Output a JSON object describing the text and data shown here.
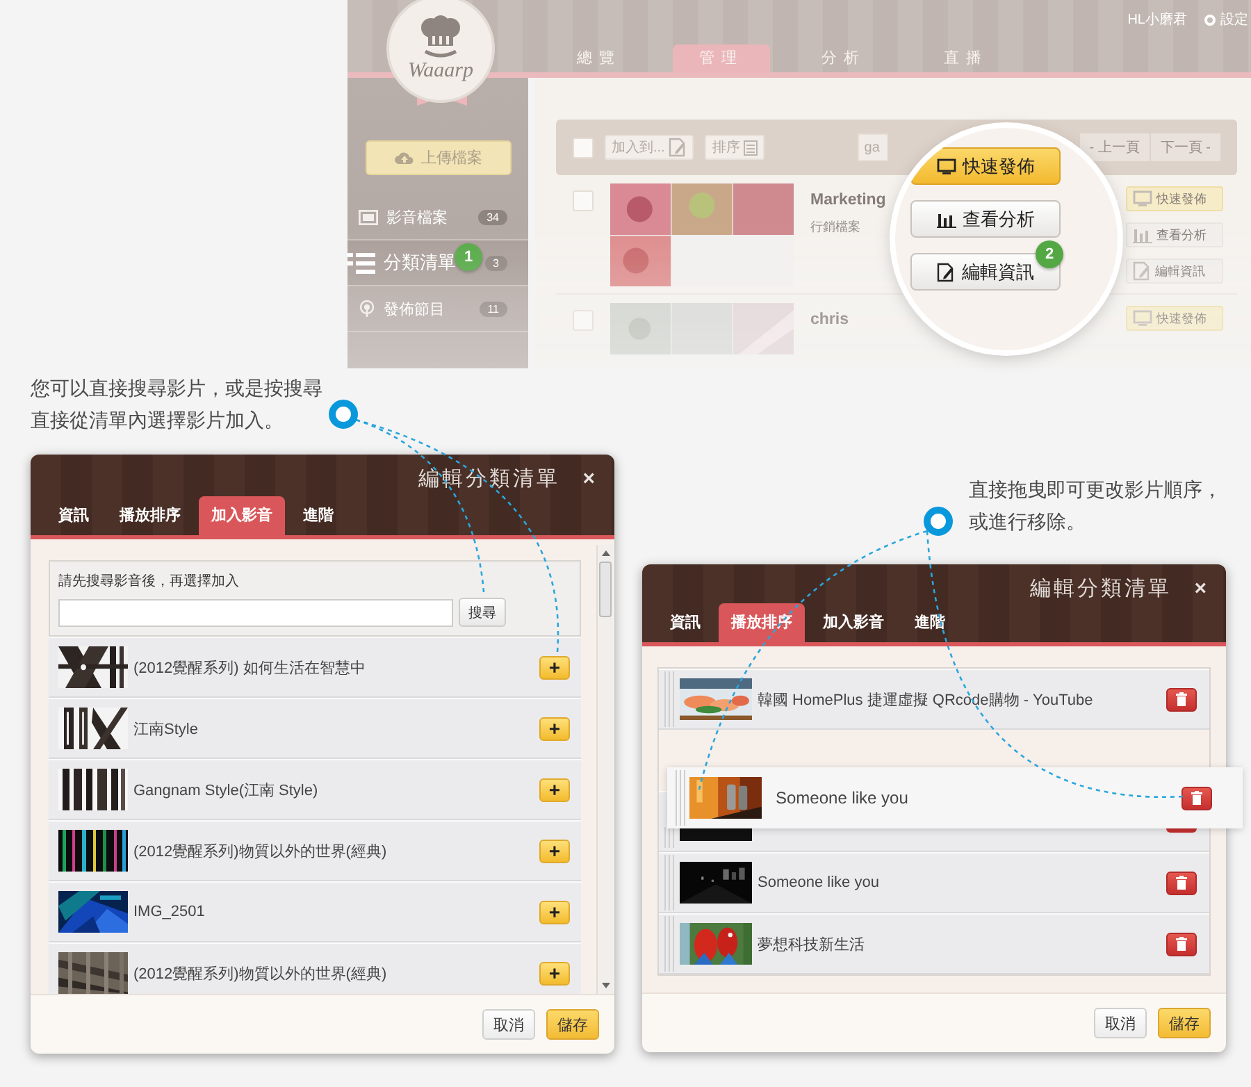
{
  "app": {
    "logo": "Waaarp",
    "user": "HL小磨君",
    "settings": "設定",
    "tabs": [
      {
        "label": "總覽",
        "selected": false
      },
      {
        "label": "管理",
        "selected": true
      },
      {
        "label": "分析",
        "selected": false
      },
      {
        "label": "直播",
        "selected": false
      }
    ],
    "upload_button": "上傳檔案",
    "sidebar": [
      {
        "label": "影音檔案",
        "count": "34",
        "selected": false
      },
      {
        "label": "分類清單",
        "count": "3",
        "selected": true,
        "step": "1"
      },
      {
        "label": "發佈節目",
        "count": "11",
        "selected": false
      }
    ],
    "toolbar": {
      "checked": false,
      "add_to": "加入到...",
      "sort": "排序",
      "search_value": "ga",
      "prev": "- 上一頁",
      "next": "下一頁 -"
    },
    "files": [
      {
        "checked": false,
        "title": "Marketing",
        "subtitle": "行銷檔案",
        "actions": [
          {
            "label": "快速發佈",
            "kind": "publish"
          },
          {
            "label": "查看分析",
            "kind": "analytics"
          },
          {
            "label": "編輯資訊",
            "kind": "edit"
          }
        ]
      },
      {
        "checked": false,
        "title": "chris",
        "actions": [
          {
            "label": "快速發佈",
            "kind": "publish"
          }
        ]
      }
    ],
    "magnifier": {
      "step": "2",
      "actions": [
        {
          "label": "快速發佈",
          "kind": "publish"
        },
        {
          "label": "查看分析",
          "kind": "analytics"
        },
        {
          "label": "編輯資訊",
          "kind": "edit"
        }
      ]
    }
  },
  "hints": [
    {
      "text": "您可以直接搜尋影片，或是按搜尋直接從清單內選擇影片加入。"
    },
    {
      "text": "直接拖曳即可更改影片順序，或進行移除。"
    }
  ],
  "dialogs": [
    {
      "kind": "search_add",
      "title": "編輯分類清單",
      "close": "×",
      "tabs": [
        {
          "label": "資訊",
          "selected": false
        },
        {
          "label": "播放排序",
          "selected": false
        },
        {
          "label": "加入影音",
          "selected": true
        },
        {
          "label": "進階",
          "selected": false
        }
      ],
      "search": {
        "label": "請先搜尋影音後，再選擇加入",
        "button": "搜尋"
      },
      "items": [
        {
          "title": "(2012覺醒系列) 如何生活在智慧中",
          "action": "+"
        },
        {
          "title": "江南Style",
          "action": "+"
        },
        {
          "title": "Gangnam Style(江南 Style)",
          "action": "+"
        },
        {
          "title": "(2012覺醒系列)物質以外的世界(經典)",
          "action": "+"
        },
        {
          "title": "IMG_2501",
          "action": "+"
        },
        {
          "title": "(2012覺醒系列)物質以外的世界(經典)",
          "action": "+"
        }
      ],
      "buttons": [
        "取消",
        "儲存"
      ]
    },
    {
      "kind": "reorder",
      "title": "編輯分類清單",
      "close": "×",
      "tabs": [
        {
          "label": "資訊",
          "selected": false
        },
        {
          "label": "播放排序",
          "selected": true
        },
        {
          "label": "加入影音",
          "selected": false
        },
        {
          "label": "進階",
          "selected": false
        }
      ],
      "items": [
        {
          "kind": "video",
          "title": "韓國 HomePlus 捷運虛擬 QRcode購物 - YouTube"
        },
        {
          "kind": "drop_slot"
        },
        {
          "kind": "covered"
        },
        {
          "kind": "video",
          "title": "Someone like you"
        },
        {
          "kind": "video",
          "title": "夢想科技新生活"
        }
      ],
      "dragged": {
        "title": "Someone like you"
      },
      "buttons": [
        "取消",
        "儲存"
      ]
    }
  ]
}
